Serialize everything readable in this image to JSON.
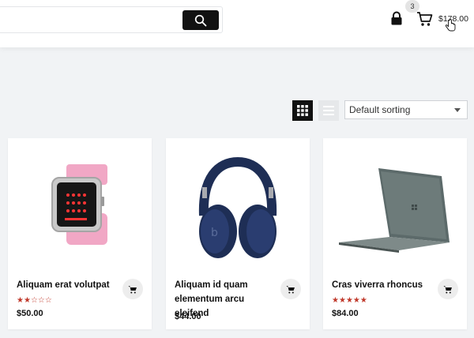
{
  "header": {
    "search": {
      "value": "",
      "placeholder": ""
    },
    "cart_count": "3",
    "cart_total": "$178.00"
  },
  "toolbar": {
    "sort": {
      "selected": "Default sorting"
    }
  },
  "products": [
    {
      "name": "Aliquam erat volutpat",
      "price": "$50.00",
      "rating": 2,
      "max_rating": 5
    },
    {
      "name": "Aliquam id quam elementum arcu eleifend",
      "price": "$44.00",
      "rating": null,
      "max_rating": 5
    },
    {
      "name": "Cras viverra rhoncus",
      "price": "$84.00",
      "rating": 5,
      "max_rating": 5
    }
  ],
  "icons": {
    "search": "search-icon",
    "lock": "lock-icon",
    "cart": "cart-icon",
    "grid": "grid-view-icon",
    "list": "list-view-icon",
    "add_to_cart": "cart-icon"
  },
  "colors": {
    "accent": "#111111",
    "rating": "#c0392b",
    "background": "#f1f3f5"
  }
}
